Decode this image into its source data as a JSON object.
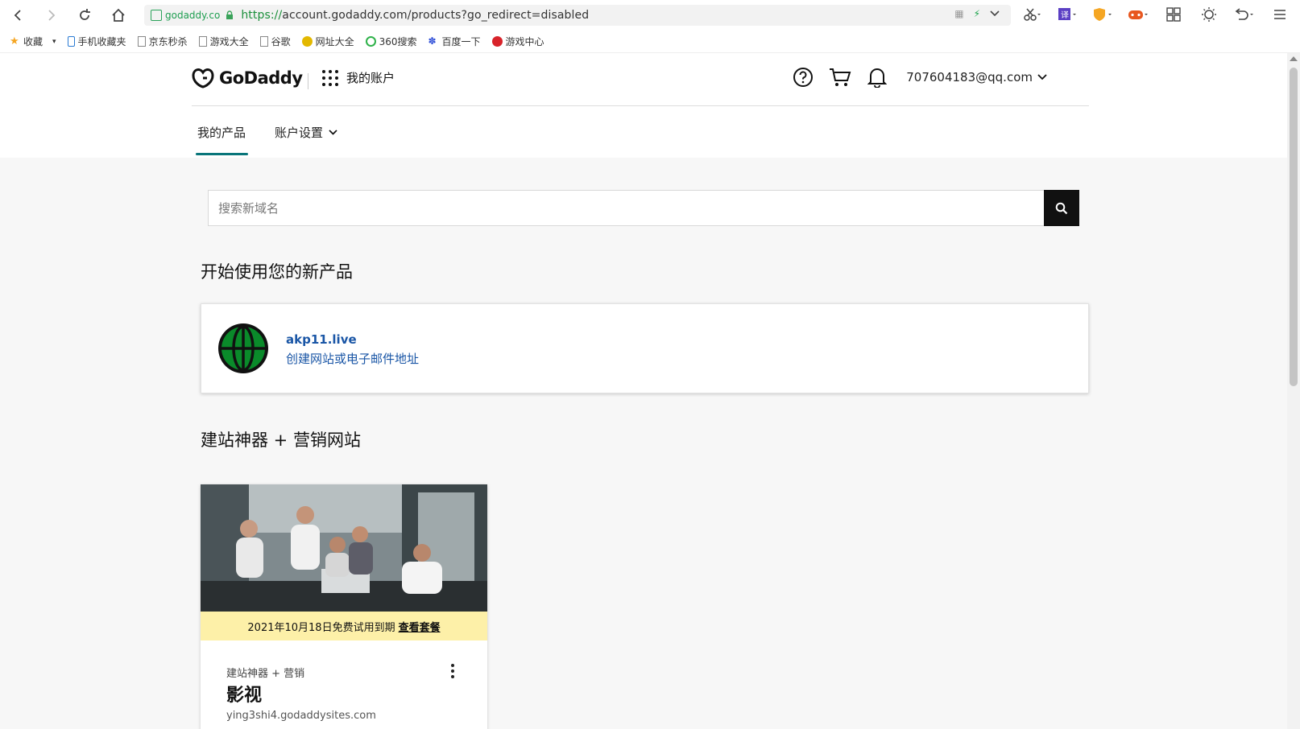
{
  "browser": {
    "site_chip": "godaddy.co",
    "url_scheme": "https://",
    "url_rest": "account.godaddy.com/products?go_redirect=disabled",
    "bookmarks": [
      {
        "label": "收藏",
        "icon": "star-icon"
      },
      {
        "label": "手机收藏夹",
        "icon": "phone-icon"
      },
      {
        "label": "京东秒杀",
        "icon": "page-icon"
      },
      {
        "label": "游戏大全",
        "icon": "page-icon"
      },
      {
        "label": "谷歌",
        "icon": "page-icon"
      },
      {
        "label": "网址大全",
        "icon": "web-icon"
      },
      {
        "label": "360搜索",
        "icon": "search360-icon"
      },
      {
        "label": "百度一下",
        "icon": "baidu-icon"
      },
      {
        "label": "游戏中心",
        "icon": "game-icon"
      }
    ]
  },
  "header": {
    "logo_text": "GoDaddy",
    "apps_label": "我的账户",
    "user_email": "707604183@qq.com"
  },
  "tabs": {
    "products": "我的产品",
    "settings": "账户设置"
  },
  "search": {
    "placeholder": "搜索新域名"
  },
  "new_products": {
    "title": "开始使用您的新产品",
    "domain": "akp11.live",
    "action": "创建网站或电子邮件地址"
  },
  "website_section": {
    "title": "建站神器 + 营销网站",
    "trial_text": "2021年10月18日免费试用到期",
    "trial_link": "查看套餐",
    "site_type": "建站神器 + 营销",
    "site_name": "影视",
    "site_url": "ying3shi4.godaddysites.com"
  },
  "colors": {
    "accent": "#09757a",
    "link": "#1a56a6",
    "trial_bg": "#fdf0a8",
    "globe": "#0a8a2a"
  }
}
